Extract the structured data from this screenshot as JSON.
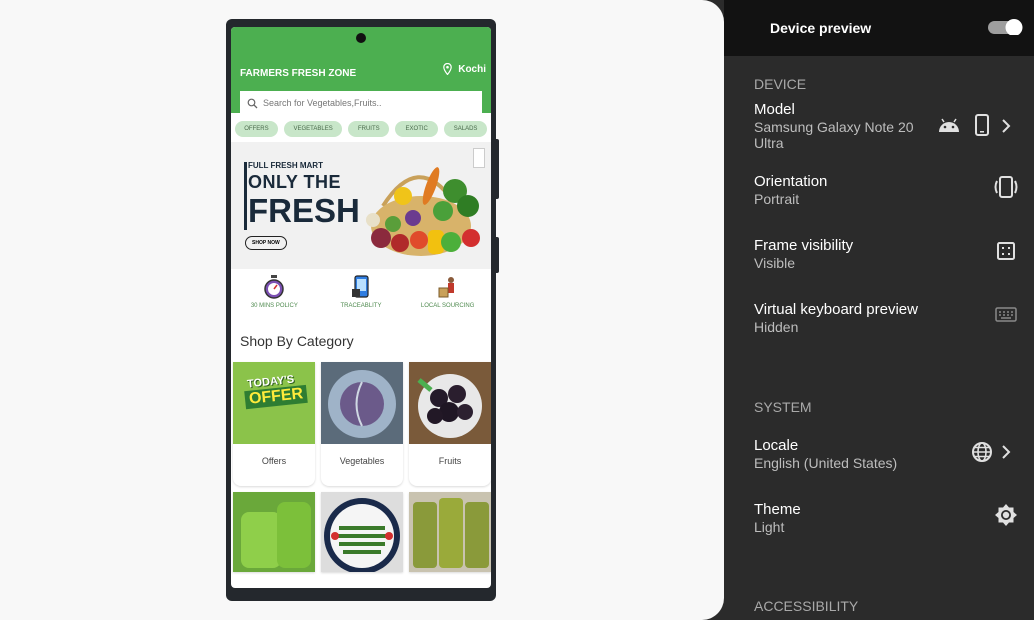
{
  "app": {
    "brand": "FARMERS FRESH ZONE",
    "location": "Kochi",
    "search_placeholder": "Search for Vegetables,Fruits..",
    "chips": [
      "OFFERS",
      "VEGETABLES",
      "FRUITS",
      "EXOTIC",
      "SALADS"
    ],
    "banner": {
      "line1": "FULL FRESH MART",
      "line2": "ONLY THE",
      "line3": "FRESH",
      "button": "SHOP NOW"
    },
    "features": [
      "30 MINS POLICY",
      "TRACEABLITY",
      "LOCAL SOURCING"
    ],
    "shop_title": "Shop By Category",
    "categories": [
      "Offers",
      "Vegetables",
      "Fruits"
    ],
    "offer_badge": {
      "line1": "TODAY'S",
      "line2": "OFFER"
    }
  },
  "panel": {
    "title": "Device preview",
    "device_section": "DEVICE",
    "model": {
      "title": "Model",
      "value": "Samsung Galaxy Note 20",
      "value2": "Ultra"
    },
    "orientation": {
      "title": "Orientation",
      "value": "Portrait"
    },
    "frame": {
      "title": "Frame visibility",
      "value": "Visible"
    },
    "keyboard": {
      "title": "Virtual keyboard preview",
      "value": "Hidden"
    },
    "system_section": "SYSTEM",
    "locale": {
      "title": "Locale",
      "value": "English (United States)"
    },
    "theme": {
      "title": "Theme",
      "value": "Light"
    },
    "accessibility_section": "ACCESSIBILITY"
  },
  "colors": {
    "primary": "#4caf50",
    "chip": "#c8e6c9",
    "panel": "#2b2b2b"
  }
}
